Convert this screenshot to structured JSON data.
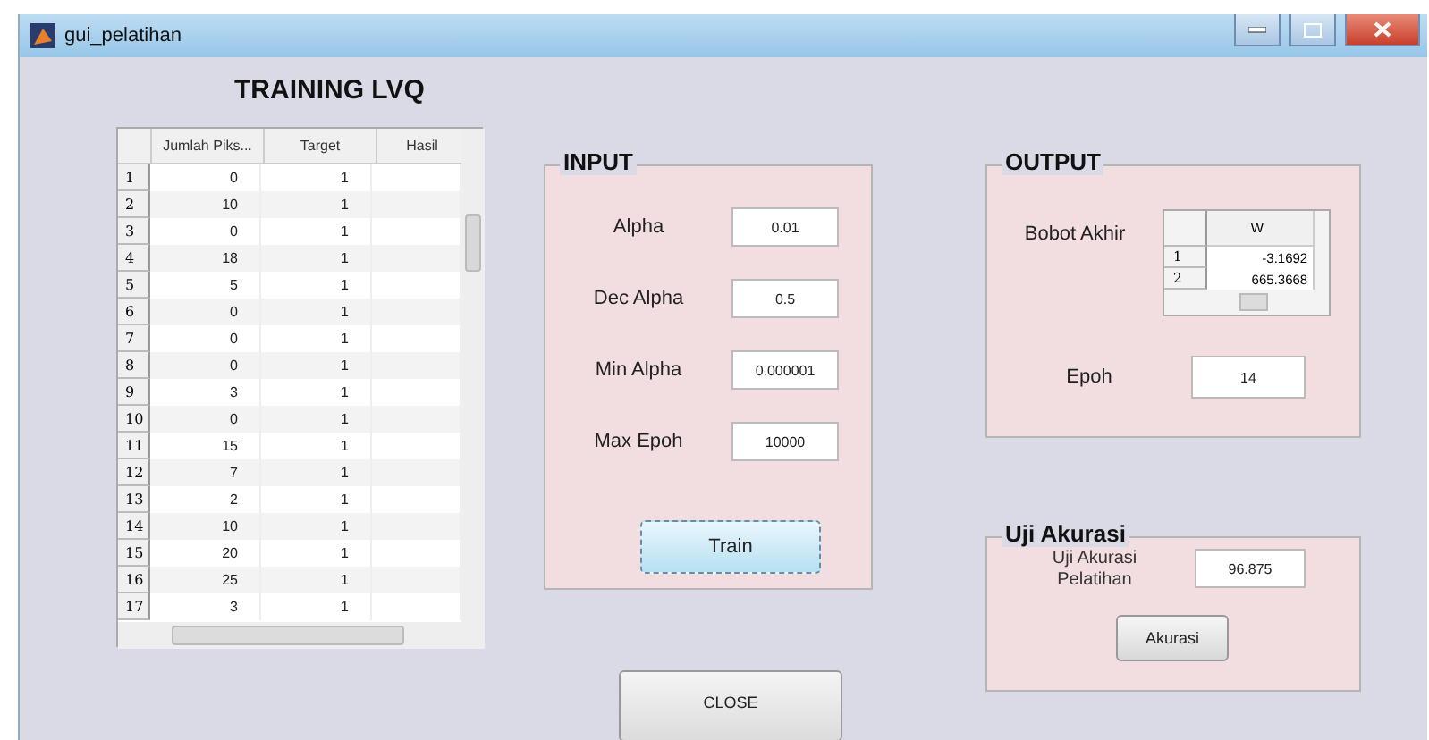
{
  "window": {
    "title": "gui_pelatihan"
  },
  "heading": "TRAINING LVQ",
  "data_table": {
    "columns": [
      "Jumlah Piks...",
      "Target",
      "Hasil"
    ],
    "rows": [
      {
        "number": "1",
        "values": [
          "0",
          "1"
        ]
      },
      {
        "number": "2",
        "values": [
          "10",
          "1"
        ]
      },
      {
        "number": "3",
        "values": [
          "0",
          "1"
        ]
      },
      {
        "number": "4",
        "values": [
          "18",
          "1"
        ]
      },
      {
        "number": "5",
        "values": [
          "5",
          "1"
        ]
      },
      {
        "number": "6",
        "values": [
          "0",
          "1"
        ]
      },
      {
        "number": "7",
        "values": [
          "0",
          "1"
        ]
      },
      {
        "number": "8",
        "values": [
          "0",
          "1"
        ]
      },
      {
        "number": "9",
        "values": [
          "3",
          "1"
        ]
      },
      {
        "number": "10",
        "values": [
          "0",
          "1"
        ]
      },
      {
        "number": "11",
        "values": [
          "15",
          "1"
        ]
      },
      {
        "number": "12",
        "values": [
          "7",
          "1"
        ]
      },
      {
        "number": "13",
        "values": [
          "2",
          "1"
        ]
      },
      {
        "number": "14",
        "values": [
          "10",
          "1"
        ]
      },
      {
        "number": "15",
        "values": [
          "20",
          "1"
        ]
      },
      {
        "number": "16",
        "values": [
          "25",
          "1"
        ]
      },
      {
        "number": "17",
        "values": [
          "3",
          "1"
        ]
      }
    ]
  },
  "input_panel": {
    "title": "INPUT",
    "fields": [
      {
        "label": "Alpha",
        "value": "0.01"
      },
      {
        "label": "Dec Alpha",
        "value": "0.5"
      },
      {
        "label": "Min Alpha",
        "value": "0.000001"
      },
      {
        "label": "Max Epoh",
        "value": "10000"
      }
    ],
    "button": "Train"
  },
  "close_button": "CLOSE",
  "output_panel": {
    "title": "OUTPUT",
    "weights_label": "Bobot Akhir",
    "weights_table": {
      "column": "W",
      "rows": [
        {
          "number": "1",
          "value": "-3.1692"
        },
        {
          "number": "2",
          "value": "665.3668"
        }
      ]
    },
    "epoh_label": "Epoh",
    "epoh_value": "14"
  },
  "accuracy_panel": {
    "title": "Uji Akurasi",
    "label": "Uji Akurasi Pelatihan",
    "value": "96.875",
    "button": "Akurasi"
  }
}
